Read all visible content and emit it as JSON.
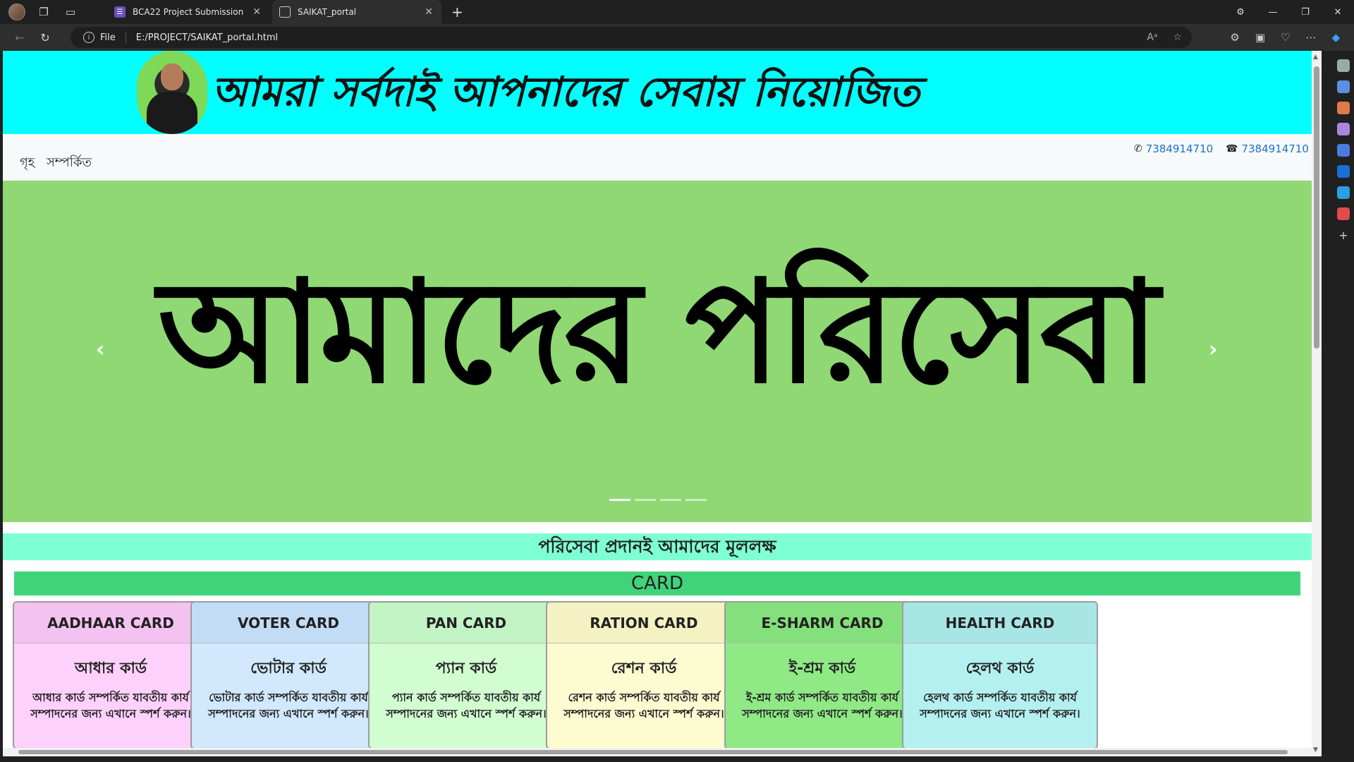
{
  "browser": {
    "tabs": [
      {
        "label": "BCA22 Project Submission"
      },
      {
        "label": "SAIKAT_portal"
      }
    ],
    "address": {
      "scheme": "File",
      "url": "E:/PROJECT/SAIKAT_portal.html"
    }
  },
  "page": {
    "banner_title": "আমরা সর্বদাই আপনাদের সেবায় নিয়োজিত",
    "nav": {
      "home": "গৃহ",
      "about": "সম্পর্কিত"
    },
    "contacts": {
      "whatsapp": "7384914710",
      "phone": "7384914710"
    },
    "carousel": {
      "text": "আমাদের পরিসেবা",
      "slide_count": 4,
      "active_slide": 1
    },
    "mission": "পরিসেবা প্রদানই আমাদের মূললক্ষ",
    "section_title": "CARD",
    "cards": [
      {
        "header": "AADHAAR CARD",
        "title": "আধার কার্ড",
        "desc": "আধার কার্ড সম্পর্কিত যাবতীয় কার্য সম্পাদনের জন্য এখানে স্পর্শ করুন।",
        "header_color": "#f4c2f0",
        "body_color": "#fdd1fb"
      },
      {
        "header": "VOTER CARD",
        "title": "ভোটার কার্ড",
        "desc": "ভোটার কার্ড সম্পর্কিত যাবতীয় কার্য সম্পাদনের জন্য এখানে স্পর্শ করুন।",
        "header_color": "#c2dcf6",
        "body_color": "#d1e8fd"
      },
      {
        "header": "PAN CARD",
        "title": "প্যান কার্ড",
        "desc": "প্যান কার্ড সম্পর্কিত যাবতীয় কার্য সম্পাদনের জন্য এখানে স্পর্শ করুন।",
        "header_color": "#c2f4c6",
        "body_color": "#d1fdd1"
      },
      {
        "header": "RATION CARD",
        "title": "রেশন কার্ড",
        "desc": "রেশন কার্ড সম্পর্কিত যাবতীয় কার্য সম্পাদনের জন্য এখানে স্পর্শ করুন।",
        "header_color": "#f4f2c2",
        "body_color": "#fdfcd1"
      },
      {
        "header": "E-SHARM CARD",
        "title": "ই-শ্রম কার্ড",
        "desc": "ই-শ্রম কার্ড সম্পর্কিত যাবতীয় কার্য সম্পাদনের জন্য এখানে স্পর্শ করুন।",
        "header_color": "#84e07d",
        "body_color": "#8fe985"
      },
      {
        "header": "HEALTH CARD",
        "title": "হেলথ কার্ড",
        "desc": "হেলথ কার্ড সম্পর্কিত যাবতীয় কার্য সম্পাদনের জন্য এখানে স্পর্শ করুন।",
        "header_color": "#a8e6e6",
        "body_color": "#b4f0f0"
      }
    ]
  }
}
